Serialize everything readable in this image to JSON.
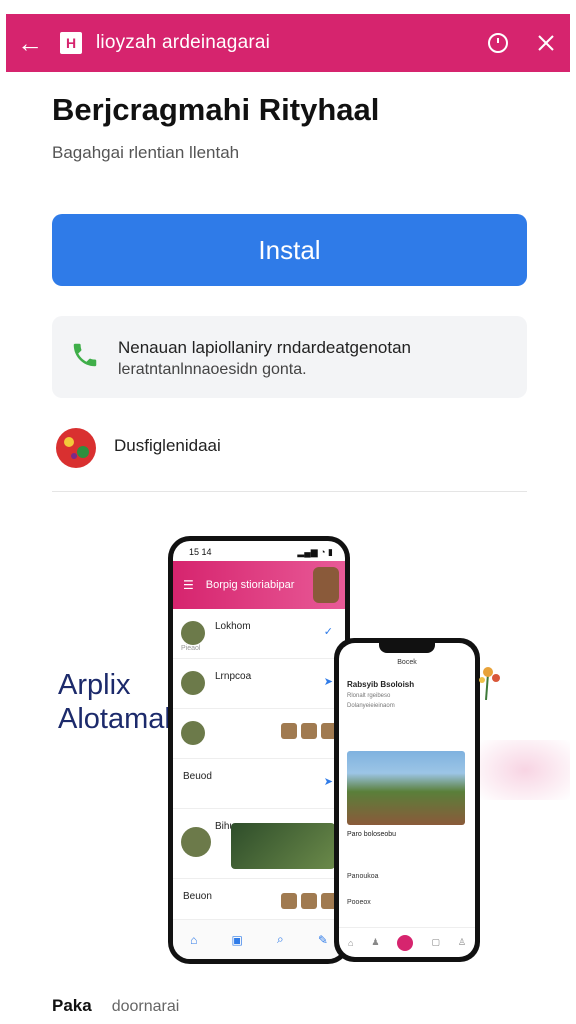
{
  "topbar": {
    "title": "lioyzah ardeinagarai",
    "back_icon": "arrow-left-icon",
    "app_icon": "app-glyph-icon",
    "app_glyph": "H",
    "history_icon": "clock-icon",
    "close_icon": "close-icon",
    "color": "#d6246e"
  },
  "app": {
    "name": "Berjcragmahi Rityhaal",
    "subtitle": "Bagahgai rlentian llentah"
  },
  "install": {
    "label": "Instal",
    "color": "#2f7be8"
  },
  "call_card": {
    "icon": "phone-icon",
    "line1": "Nenauan lapiollaniry rndardeatgenotan",
    "line2": "leratntanlnnaoesidn gonta."
  },
  "developer": {
    "icon": "developer-avatar-icon",
    "name": "Dusfiglenidaai"
  },
  "promo": {
    "line1": "Arplix",
    "line2": "Alotamalnilkitin"
  },
  "mockup_back": {
    "status_time": "15 14",
    "status_icons": "▂▄▆ ◔ ▮",
    "header_title": "Borpig stioriabipar",
    "menu_icon": "☰",
    "rows": [
      {
        "name": "Lokhom",
        "sub": "Pieaol"
      },
      {
        "name": "Lrnpcoa",
        "sub": ""
      },
      {
        "name": "",
        "sub": ""
      },
      {
        "name": "Beuod",
        "sub": ""
      },
      {
        "name": "Bihuuo",
        "sub": ""
      },
      {
        "name": "Beuon",
        "sub": ""
      }
    ],
    "bottom_icons": [
      "⌂",
      "▣",
      "⌕",
      "✎"
    ]
  },
  "mockup_front": {
    "status": "Bocek",
    "title": "Rabsyib Bsoloish",
    "sub": "Rlonalt rgeibeso",
    "sub2": "Dolanyeieieinaom",
    "caption": "Paro boloseobu",
    "items": [
      "Panoukoa",
      "Pooeox"
    ],
    "nav_icons": [
      "⌂",
      "♟",
      "●",
      "▢",
      "♙"
    ]
  },
  "footer": {
    "label1": "Paka",
    "label2": "doornarai"
  }
}
